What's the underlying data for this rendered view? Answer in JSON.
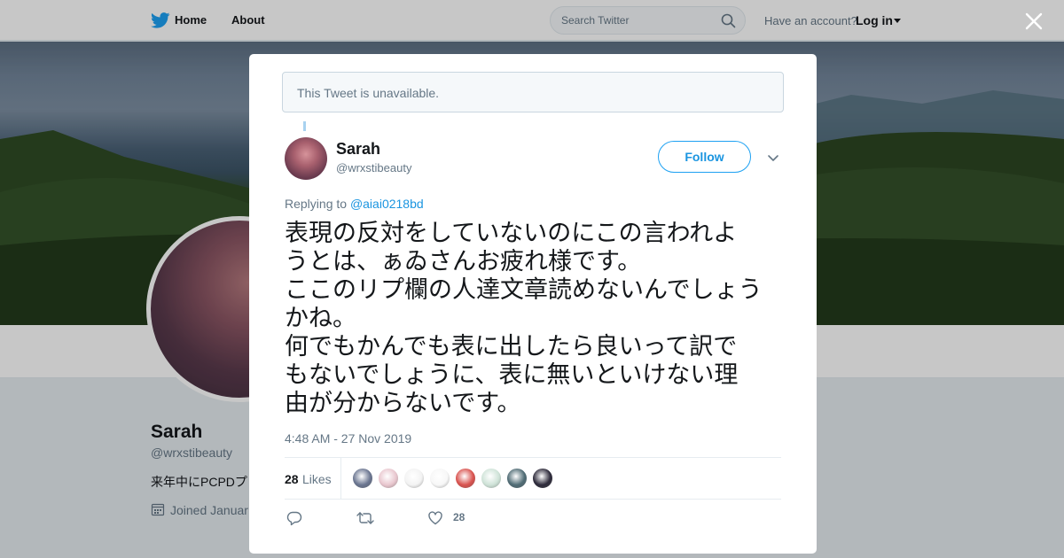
{
  "nav": {
    "home_label": "Home",
    "about_label": "About",
    "search_placeholder": "Search Twitter",
    "have_account": "Have an account?",
    "login_label": "Log in"
  },
  "profile": {
    "name": "Sarah",
    "handle": "@wrxstibeauty",
    "bio_visible": "来年中にPCPDプ",
    "joined_visible": "Joined Januar"
  },
  "modal": {
    "unavailable_notice": "This Tweet is unavailable.",
    "tweet": {
      "author_name": "Sarah",
      "author_handle": "@wrxstibeauty",
      "follow_label": "Follow",
      "replying_to_label": "Replying to ",
      "replying_to_handle": "@aiai0218bd",
      "text": "表現の反対をしていないのにこの言われよ\nうとは、ぁゐさんお疲れ様です。\nここのリプ欄の人達文章読めないんでしょう\nかね。\n何でもかんでも表に出したら良いって訳で\nもないでしょうに、表に無いといけない理\n由が分からないです。",
      "timestamp": "4:48 AM - 27 Nov 2019",
      "likes_count": "28",
      "likes_label": "Likes",
      "like_action_count": "28"
    }
  },
  "colors": {
    "twitter_blue": "#1da1f2",
    "link_blue": "#1b95e0",
    "secondary_text": "#657786",
    "page_background": "#e6ecf0"
  },
  "likers": [
    {
      "name": "liker-1",
      "color": "#6a7590"
    },
    {
      "name": "liker-2",
      "color": "#e9c7cf"
    },
    {
      "name": "liker-3",
      "color": "#f3f3f3"
    },
    {
      "name": "liker-4",
      "color": "#f7f7f7"
    },
    {
      "name": "liker-5",
      "color": "#d9534f"
    },
    {
      "name": "liker-6",
      "color": "#cfe3d8"
    },
    {
      "name": "liker-7",
      "color": "#4f6b74"
    },
    {
      "name": "liker-8",
      "color": "#2d2a3a"
    }
  ]
}
